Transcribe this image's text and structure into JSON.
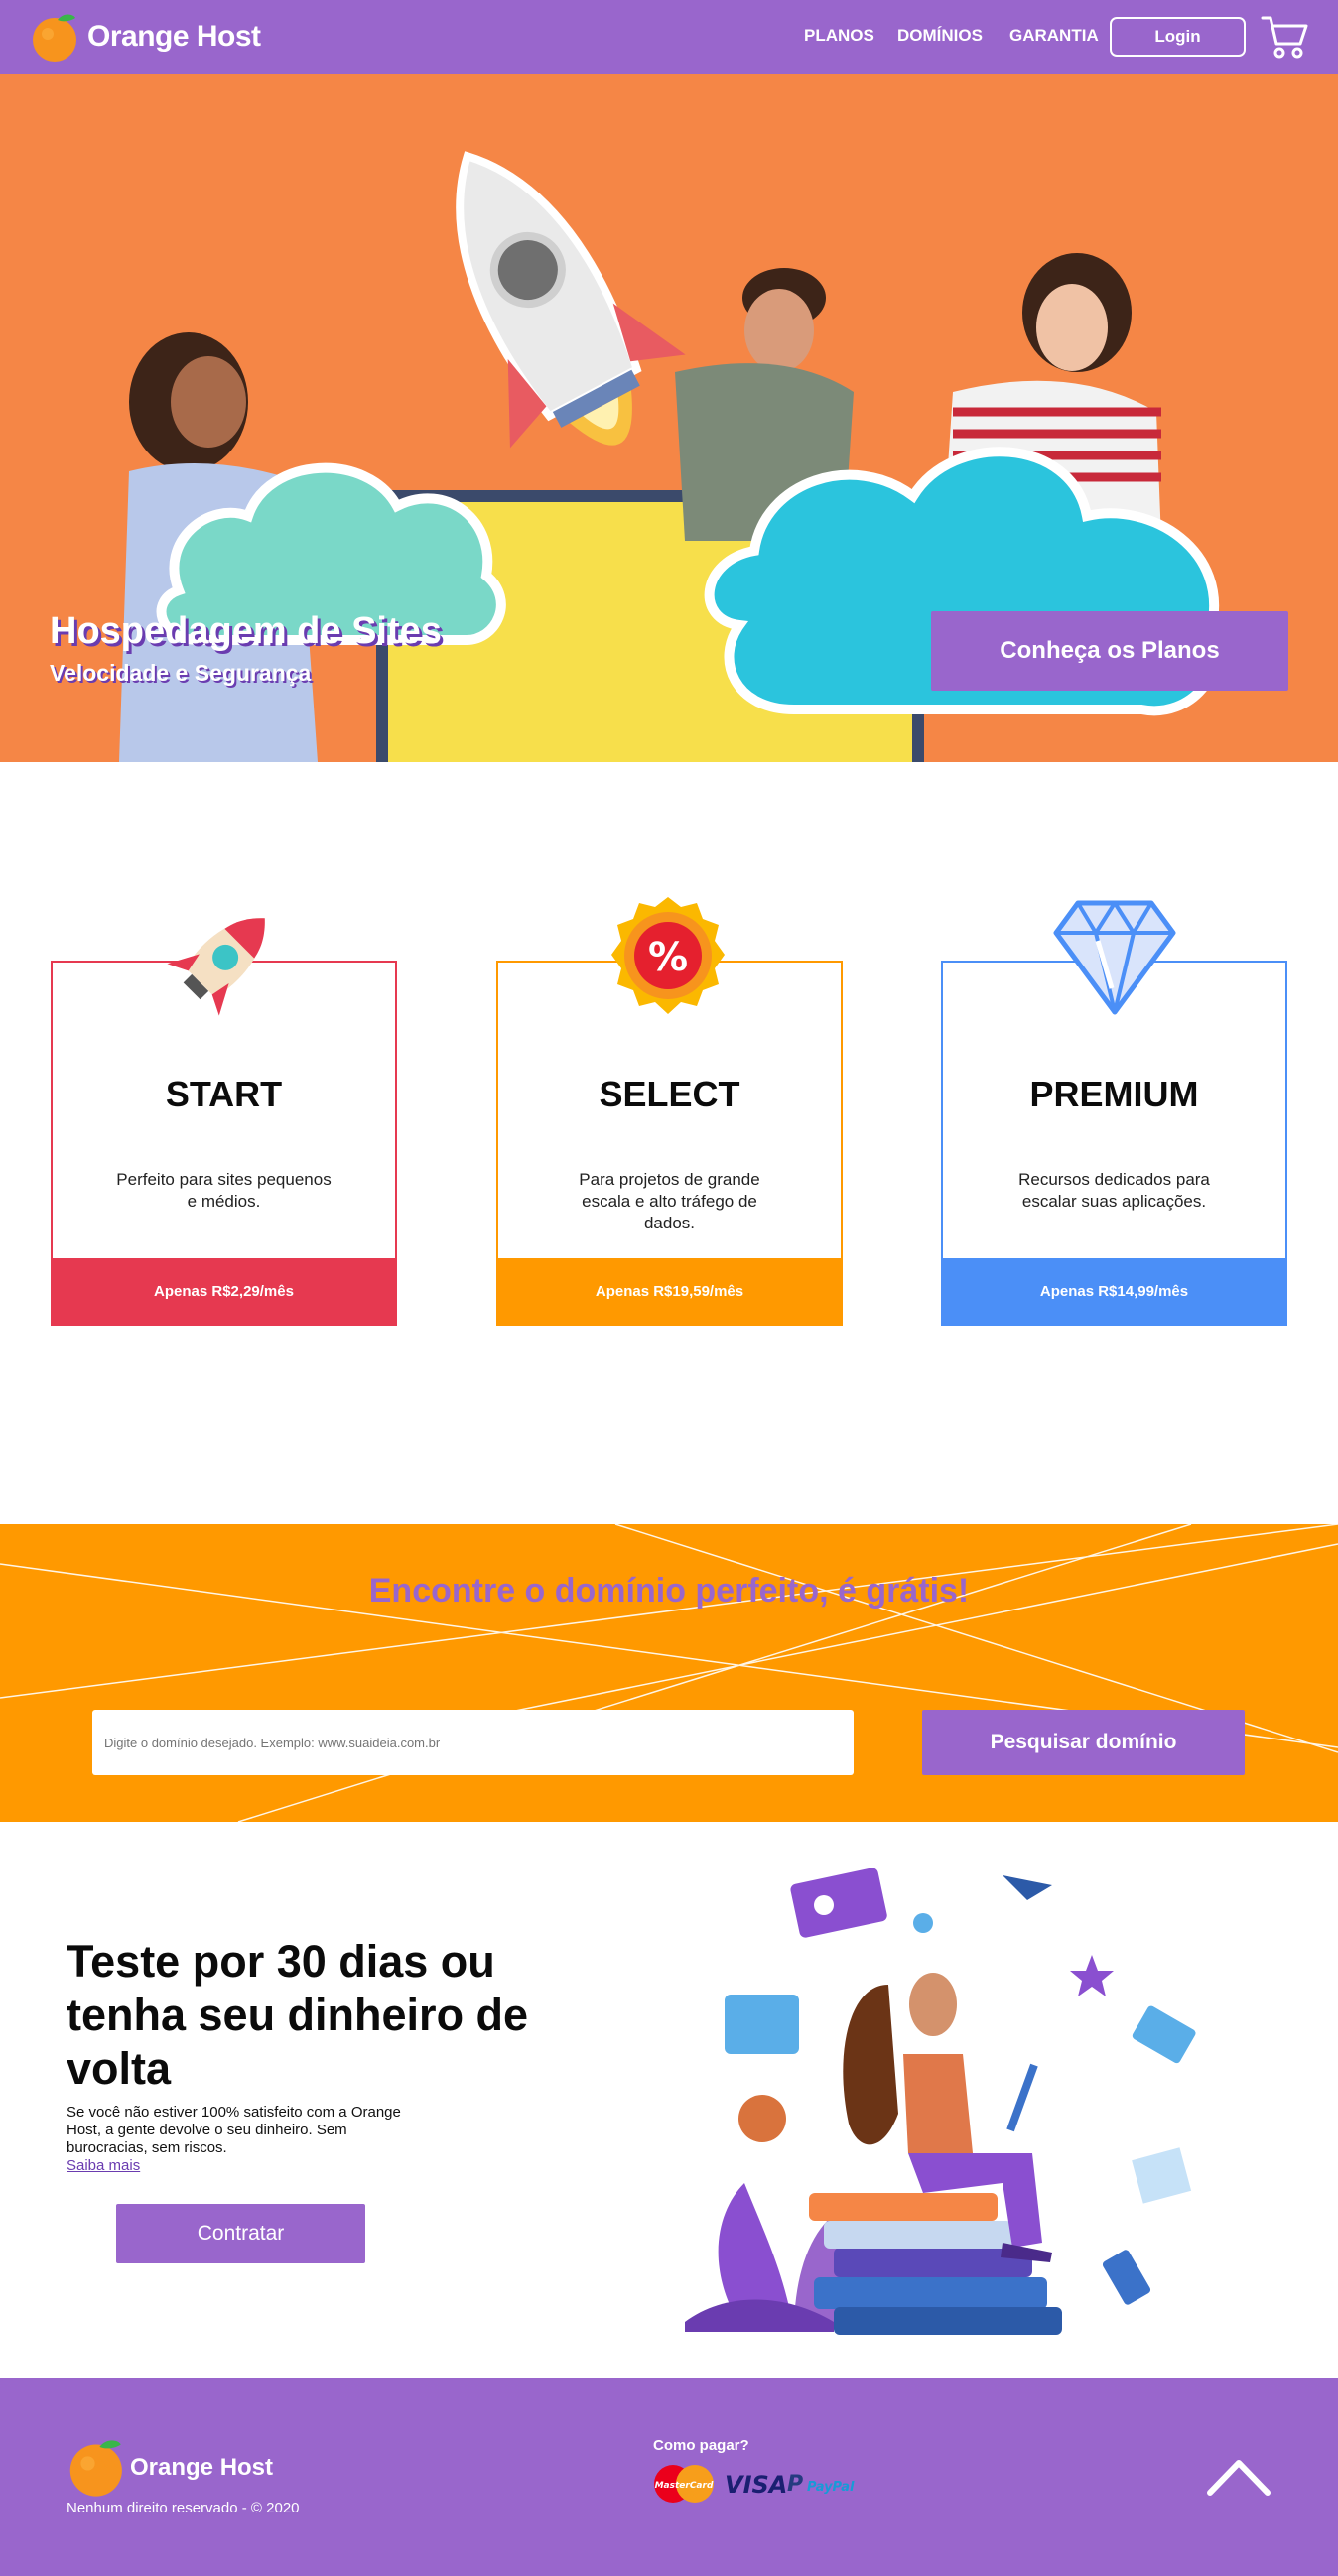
{
  "nav": {
    "brand": "Orange Host",
    "links": [
      "PLANOS",
      "DOMÍNIOS",
      "GARANTIA"
    ],
    "login": "Login"
  },
  "hero": {
    "title": "Hospedagem de Sites",
    "subtitle": "Velocidade e Segurança",
    "cta": "Conheça os Planos"
  },
  "plans": [
    {
      "name": "START",
      "description": "Perfeito para sites pequenos e médios.",
      "price": "Apenas R$2,29/mês",
      "color": "#e63950",
      "icon": "rocket-icon"
    },
    {
      "name": "SELECT",
      "description": "Para projetos de grande escala e alto tráfego de dados.",
      "price": "Apenas R$19,59/mês",
      "color": "#ff9900",
      "icon": "percent-badge-icon"
    },
    {
      "name": "PREMIUM",
      "description": "Recursos dedicados para escalar suas aplicações.",
      "price": "Apenas R$14,99/mês",
      "color": "#4b8ff7",
      "icon": "diamond-icon"
    }
  ],
  "domain": {
    "heading": "Encontre o domínio perfeito, é grátis!",
    "placeholder": "Digite o domínio desejado. Exemplo: www.suaideia.com.br",
    "button": "Pesquisar domínio"
  },
  "guarantee": {
    "headline": "Teste por 30 dias ou tenha seu dinheiro de volta",
    "body": "Se você não estiver 100% satisfeito com a Orange Host, a gente devolve o seu dinheiro. Sem burocracias, sem riscos.",
    "link": "Saiba mais",
    "button": "Contratar"
  },
  "footer": {
    "brand": "Orange Host",
    "copyright": "Nenhum direito reservado - © 2020",
    "pay_label": "Como pagar?",
    "payment_methods": [
      "MasterCard",
      "VISA",
      "PayPal"
    ]
  },
  "colors": {
    "purple": "#9966cc",
    "orange": "#ff9900",
    "hero_orange": "#f58646"
  }
}
